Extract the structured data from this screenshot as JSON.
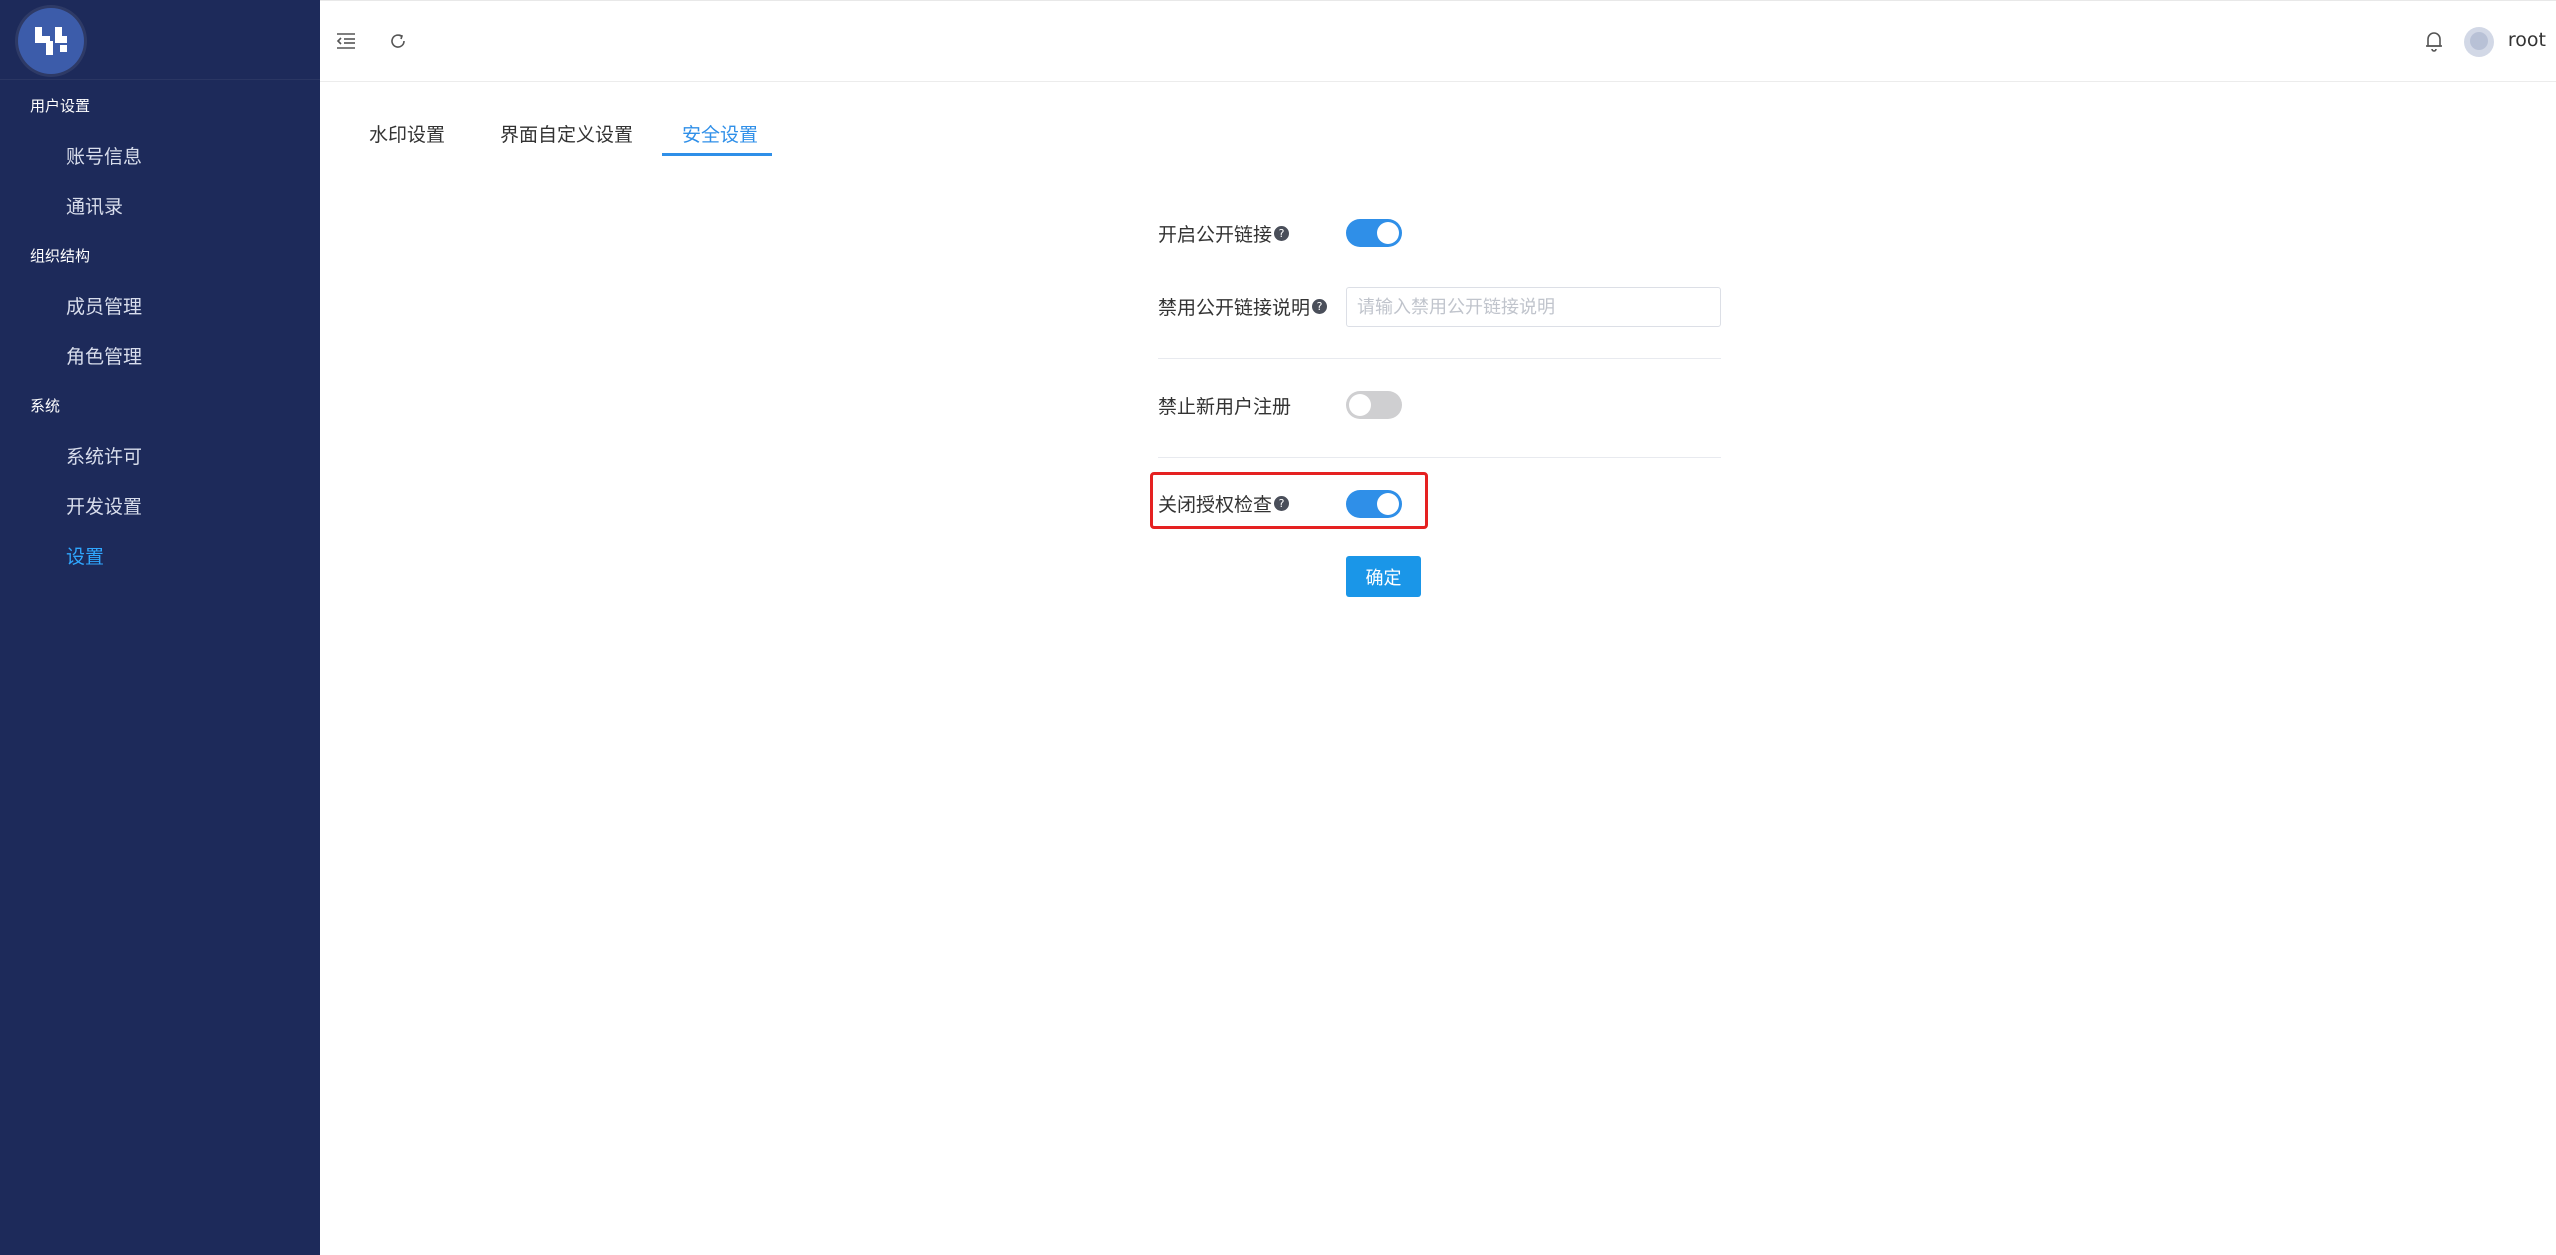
{
  "sidebar": {
    "groups": [
      {
        "label": "用户设置",
        "items": [
          "账号信息",
          "通讯录"
        ]
      },
      {
        "label": "组织结构",
        "items": [
          "成员管理",
          "角色管理"
        ]
      },
      {
        "label": "系统",
        "items": [
          "系统许可",
          "开发设置",
          "设置"
        ]
      }
    ],
    "active_item": "设置"
  },
  "header": {
    "username": "root",
    "icons": [
      "menu-fold-icon",
      "refresh-icon",
      "bell-icon",
      "avatar"
    ]
  },
  "tabs": {
    "items": [
      "水印设置",
      "界面自定义设置",
      "安全设置"
    ],
    "active": "安全设置"
  },
  "form": {
    "public_link": {
      "label": "开启公开链接",
      "enabled": true
    },
    "disable_public_link_desc": {
      "label": "禁用公开链接说明",
      "value": "",
      "placeholder": "请输入禁用公开链接说明"
    },
    "forbid_registration": {
      "label": "禁止新用户注册",
      "enabled": false
    },
    "disable_auth_check": {
      "label": "关闭授权检查",
      "enabled": true
    },
    "confirm_label": "确定"
  },
  "colors": {
    "sidebar_bg": "#1d2a5a",
    "accent": "#2f8fe8",
    "button": "#1a96e8",
    "highlight": "#e52121"
  }
}
